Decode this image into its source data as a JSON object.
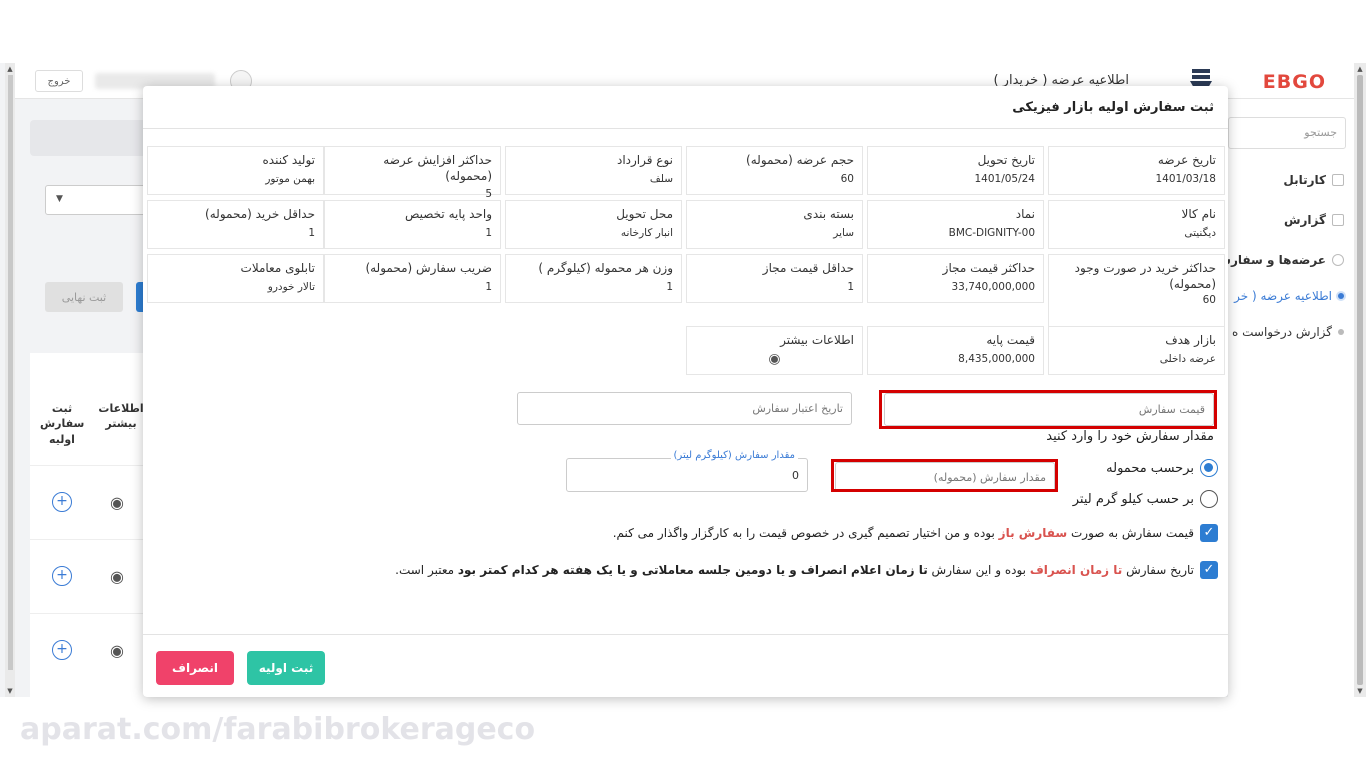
{
  "app": {
    "logout_label": "خروج",
    "page_title": "اطلاعیه عرضه ( خریدار )",
    "brand": "EBGO",
    "final_label": "ثبت نهایی",
    "search_placeholder": "جستجو",
    "sidebar": [
      {
        "label": "کارتابل",
        "kind": "icon"
      },
      {
        "label": "گزارش",
        "kind": "icon"
      },
      {
        "label": "عرضه‌ها و سفارش",
        "kind": "icon"
      },
      {
        "label": "اطلاعیه عرضه ( خر",
        "kind": "dot-active"
      },
      {
        "label": "گزارش درخواست ه",
        "kind": "dot"
      }
    ],
    "table": {
      "col_submit": "ثبت سفارش اولیه",
      "col_info": "اطلاعات بیشتر"
    }
  },
  "modal": {
    "title": "ثبت سفارش اولیه بازار فیزیکی",
    "info_rows": [
      [
        {
          "label": "تاریخ عرضه",
          "value": "1401/03/18"
        },
        {
          "label": "تاریخ تحویل",
          "value": "1401/05/24"
        },
        {
          "label": "حجم عرضه (محموله)",
          "value": "60"
        },
        {
          "label": "نوع قرارداد",
          "value": "سلف"
        },
        {
          "label": "حداکثر افزایش عرضه (محموله)",
          "value": "5"
        },
        {
          "label": "تولید کننده",
          "value": "بهمن موتور"
        }
      ],
      [
        {
          "label": "نام کالا",
          "value": "دیگنیتی"
        },
        {
          "label": "نماد",
          "value": "BMC-DIGNITY-00"
        },
        {
          "label": "بسته بندی",
          "value": "سایر"
        },
        {
          "label": "محل تحویل",
          "value": "انبار کارخانه"
        },
        {
          "label": "واحد پایه تخصیص",
          "value": "1"
        },
        {
          "label": "حداقل خرید (محموله)",
          "value": "1"
        }
      ],
      [
        {
          "label": "حداکثر خرید در صورت وجود (محموله)",
          "value": "60"
        },
        {
          "label": "حداکثر قیمت مجاز",
          "value": "33,740,000,000"
        },
        {
          "label": "حداقل قیمت مجاز",
          "value": "1"
        },
        {
          "label": "وزن هر محموله (کیلوگرم )",
          "value": "1"
        },
        {
          "label": "ضریب سفارش (محموله)",
          "value": "1"
        },
        {
          "label": "تابلوی معاملات",
          "value": "تالار خودرو"
        }
      ],
      [
        {
          "label": "بازار هدف",
          "value": "عرضه داخلی"
        },
        {
          "label": "قیمت پایه",
          "value": "8,435,000,000"
        },
        {
          "label": "اطلاعات بیشتر",
          "value": ""
        }
      ]
    ],
    "order_price_placeholder": "قیمت سفارش",
    "validity_date_placeholder": "تاریخ اعتبار سفارش",
    "prompt": "مقدار سفارش خود را وارد کنید",
    "radio_shipment": "برحسب محموله",
    "radio_kg": "بر حسب کیلو گرم لیتر",
    "qty_shipment_placeholder": "مقدار سفارش (محموله)",
    "qty_kg_label": "مقدار سفارش (کیلوگرم لیتر)",
    "qty_kg_value": "0",
    "check1": {
      "part1": "قیمت سفارش به صورت",
      "em": "سفارش باز",
      "part2": "بوده و من اختیار تصمیم گیری در خصوص قیمت را به کارگزار واگذار می کنم."
    },
    "check2": {
      "part1": "تاریخ سفارش",
      "em_red": "تا زمان انصراف",
      "part2": "بوده و این سفارش",
      "em_bold": "تا زمان اعلام انصراف و یا دومین جلسه معاملاتی و یا یک هفته هر کدام کمتر بود",
      "part3": "معتبر است."
    },
    "submit_label": "ثبت اولیه",
    "cancel_label": "انصراف"
  },
  "watermark": "aparat.com/farabibrokerageco",
  "colors": {
    "accent": "#2d7dd2",
    "submit": "#2ec4a5",
    "cancel": "#f0426a",
    "highlight": "#d40000"
  }
}
